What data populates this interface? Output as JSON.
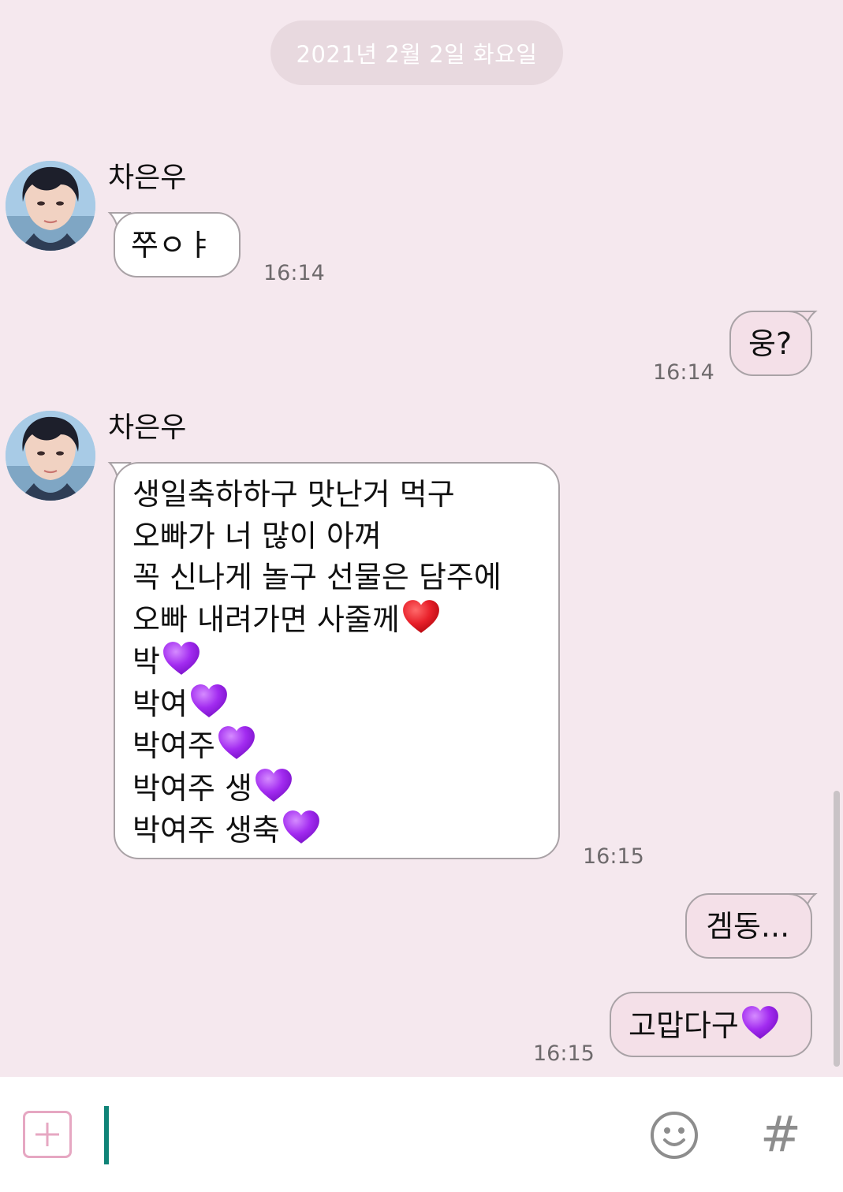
{
  "chat": {
    "date_divider": "2021년 2월 2일 화요일",
    "messages": [
      {
        "sender": "차은우",
        "direction": "incoming",
        "lines": [
          "쭈ㅇㅑ"
        ],
        "time": "16:14"
      },
      {
        "direction": "outgoing",
        "lines": [
          "웅?"
        ],
        "time": "16:14"
      },
      {
        "sender": "차은우",
        "direction": "incoming",
        "lines": [
          "생일축하하구 맛난거 먹구",
          "오빠가 너 많이 아껴",
          "꼭 신나게 놀구 선물은 담주에",
          "오빠 내려가면 사줄께",
          "박",
          "박여",
          "박여주",
          "박여주 생",
          "박여주 생축"
        ],
        "time": "16:15"
      },
      {
        "direction": "outgoing",
        "lines": [
          "겜동..."
        ]
      },
      {
        "direction": "outgoing",
        "lines": [
          "고맙다구"
        ],
        "time": "16:15"
      }
    ]
  },
  "icons": {
    "red_heart": "red-heart-emoji",
    "purple_heart": "purple-heart-emoji",
    "attach": "plus-square-icon",
    "emoji": "smiley-icon",
    "hashtag": "#"
  },
  "colors": {
    "background": "#f5e8ee",
    "incoming_bubble": "#ffffff",
    "outgoing_bubble": "#f4e0e8",
    "cursor": "#0f8377",
    "red_heart": "#e8202a",
    "purple_heart": "#a22bf0"
  }
}
